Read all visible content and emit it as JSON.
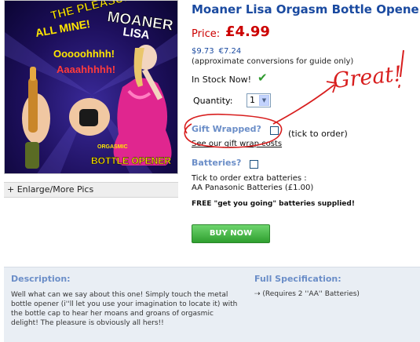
{
  "product": {
    "title": "Moaner Lisa Orgasm Bottle Opener",
    "price_label": "Price:",
    "price": "£4.99",
    "usd": "$9.73",
    "eur": "€7.24",
    "conversion_note": "(approximate conversions for guide only)",
    "stock_text": "In Stock Now!",
    "quantity_label": "Quantity:",
    "quantity_value": "1"
  },
  "image": {
    "enlarge_label": "+ Enlarge/More Pics",
    "box_text_top1": "THE PLEASURE'S",
    "box_text_top2": "ALL MINE!",
    "box_brand1": "MOANER",
    "box_brand2": "LISA",
    "box_sound1": "Ooooohhhh!",
    "box_sound2": "Aaaahhhhh!",
    "box_bottom1": "ORGASMIC",
    "box_bottom2": "BOTTLE OPENER"
  },
  "options": {
    "gift_label": "Gift Wrapped?",
    "gift_hint": "(tick to order)",
    "gift_link": "See our gift wrap costs",
    "batteries_label": "Batteries?",
    "batteries_line1": "Tick to order extra batteries :",
    "batteries_line2": "AA Panasonic Batteries (£1.00)",
    "free_note": "FREE \"get you going\" batteries supplied!",
    "buy_label": "BUY NOW"
  },
  "annotation": {
    "text": "Great!"
  },
  "description": {
    "heading": "Description:",
    "text": "Well what can we say about this one! Simply touch the metal bottle opener (i''ll let you use your imagination to locate it) with the bottle cap to hear her moans and groans of orgasmic delight! The pleasure is obviously all hers!!"
  },
  "specification": {
    "heading": "Full Specification:",
    "item": "(Requires 2 ''AA'' Batteries)"
  },
  "colors": {
    "link_blue": "#1a4aa0",
    "price_red": "#cc0000",
    "buy_green": "#3aa83a",
    "annotation_red": "#d81e1e"
  }
}
